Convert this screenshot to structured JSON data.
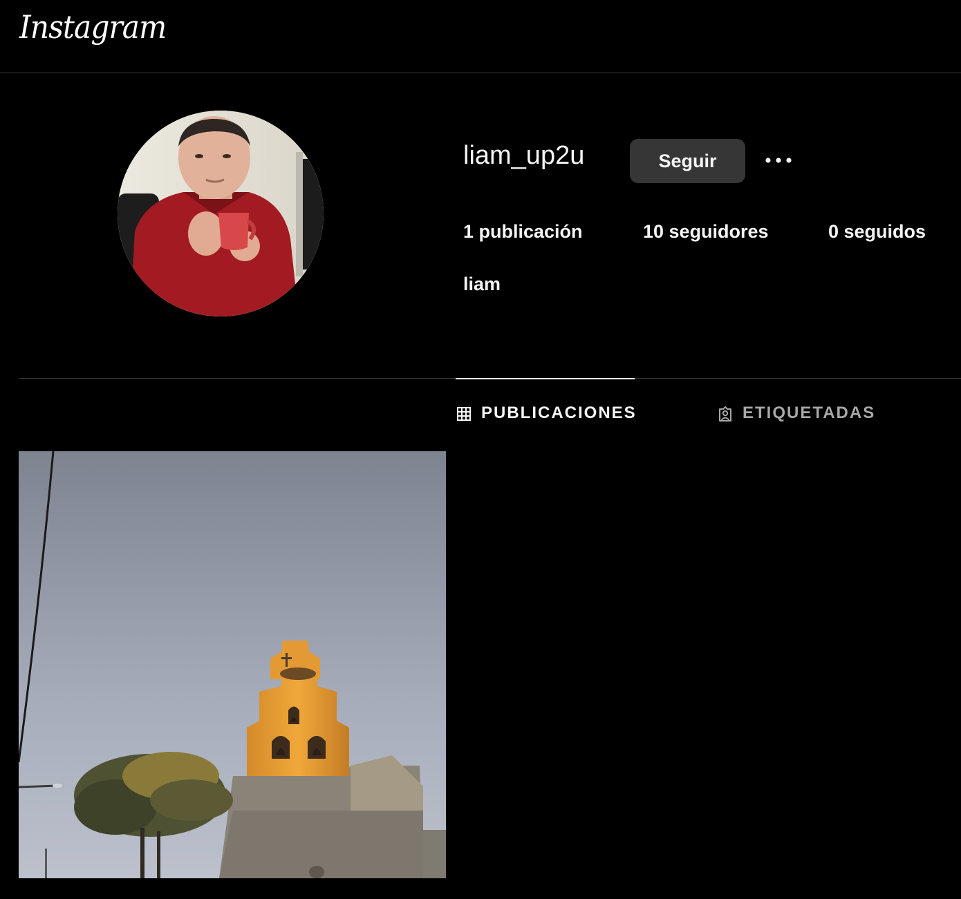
{
  "app": {
    "logo_text": "Instagram"
  },
  "profile": {
    "username": "liam_up2u",
    "follow_label": "Seguir",
    "more_icon": "more-horizontal-icon",
    "avatar_alt": "profile picture",
    "display_name": "liam",
    "stats": {
      "posts": "1 publicación",
      "followers": "10 seguidores",
      "following": "0 seguidos"
    }
  },
  "tabs": [
    {
      "label": "PUBLICACIONES",
      "icon": "grid-icon",
      "active": true
    },
    {
      "label": "ETIQUETADAS",
      "icon": "tagged-user-icon",
      "active": false
    }
  ],
  "posts": [
    {
      "thumbnail": "church-bell-tower-at-sunset"
    }
  ],
  "colors": {
    "background": "#000000",
    "text": "#f5f5f5",
    "muted_text": "#a8a8a8",
    "button_bg": "#363636",
    "divider": "#3a3a3a"
  }
}
